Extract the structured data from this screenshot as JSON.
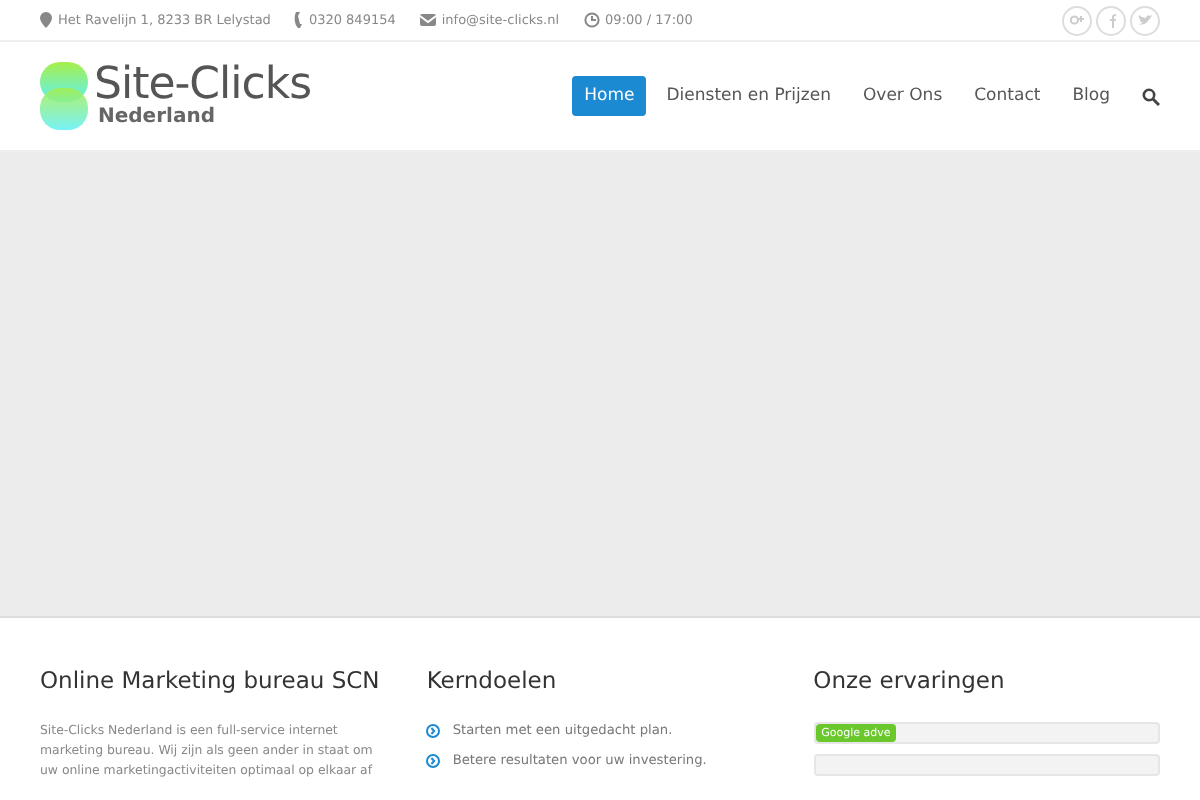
{
  "topbar": {
    "contacts": [
      {
        "kind": "pin",
        "text": "Het Ravelijn 1, 8233 BR Lelystad"
      },
      {
        "kind": "phone",
        "text": "0320 849154"
      },
      {
        "kind": "mail",
        "text": "info@site-clicks.nl"
      },
      {
        "kind": "clock",
        "text": "09:00 / 17:00"
      }
    ],
    "social": [
      {
        "kind": "gplus"
      },
      {
        "kind": "facebook"
      },
      {
        "kind": "twitter"
      }
    ]
  },
  "header": {
    "logo": {
      "title": "Site-Clicks",
      "subtitle": "Nederland"
    },
    "nav": [
      {
        "label": "Home",
        "selected": true
      },
      {
        "label": "Diensten en Prijzen",
        "selected": false
      },
      {
        "label": "Over Ons",
        "selected": false
      },
      {
        "label": "Contact",
        "selected": false
      },
      {
        "label": "Blog",
        "selected": false
      }
    ]
  },
  "columns": [
    {
      "kind": "text",
      "title": "Online Marketing bureau SCN",
      "body": "Site-Clicks Nederland is een full-service internet marketing bureau. Wij zijn als geen ander in staat om uw online marketingactiviteiten optimaal op elkaar af"
    },
    {
      "kind": "list",
      "title": "Kerndoelen",
      "items": [
        "Starten met een uitgedacht plan.",
        "Betere resultaten voor uw investering."
      ]
    },
    {
      "kind": "bars",
      "title": "Onze ervaringen",
      "bars": [
        {
          "label": "Google adve",
          "level": 0.2
        },
        {
          "level": 0
        }
      ]
    }
  ]
}
